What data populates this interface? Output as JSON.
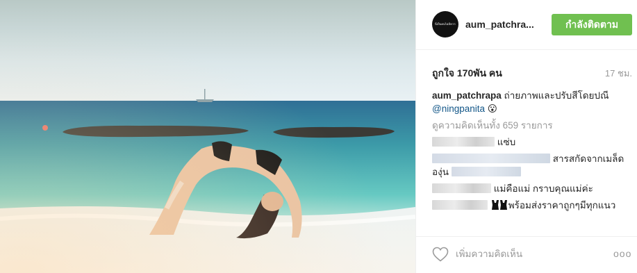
{
  "post": {
    "photo_alt": "",
    "username": "aum_patchra...",
    "avatar_text": "นี่เป็นคนไม่มีความตั้ง",
    "follow_label": "กำลังติดตาม",
    "likes": "ถูกใจ 170พัน คน",
    "time": "17 ชม."
  },
  "caption": {
    "user": "aum_patchrapa",
    "text": " ถ่ายภาพและปรับสีโดยปณี ",
    "mention": "@ningpanita",
    "emoji": "😮"
  },
  "view_all": "ดูความคิดเห็นทั้ง 659 รายการ",
  "comments": [
    {
      "text": " แซ่บ"
    },
    {
      "text": " สารสกัดจากเมล็ดองุ่น "
    },
    {
      "text": " แม่คือแม่ กราบคุณแม่ค่ะ"
    },
    {
      "text": "พร้อมส่งราคาถูกๆมีทุกแนว"
    }
  ],
  "footer": {
    "comment_placeholder": "เพิ่มความคิดเห็น",
    "more_label": "ooo"
  },
  "colors": {
    "follow_green": "#70c050",
    "mention_blue": "#125688",
    "muted": "#999999"
  },
  "icons": {
    "like": "heart-outline-icon",
    "more": "more-options-icon"
  }
}
